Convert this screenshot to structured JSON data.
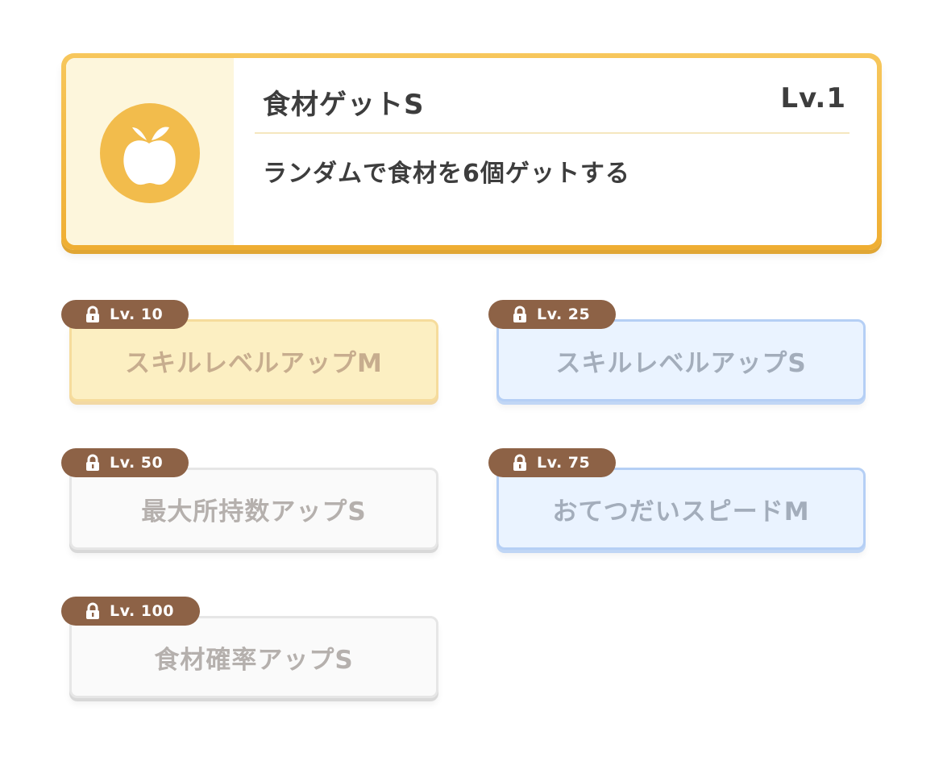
{
  "skill": {
    "icon": "apple-icon",
    "name": "食材ゲットS",
    "level": "Lv.1",
    "description": "ランダムで食材を6個ゲットする",
    "accent_color": "#f2bc4c"
  },
  "unlocks": [
    {
      "level": "Lv. 10",
      "label": "スキルレベルアップM",
      "style": "yellow"
    },
    {
      "level": "Lv. 25",
      "label": "スキルレベルアップS",
      "style": "blue"
    },
    {
      "level": "Lv. 50",
      "label": "最大所持数アップS",
      "style": "white"
    },
    {
      "level": "Lv. 75",
      "label": "おてつだいスピードM",
      "style": "blue"
    },
    {
      "level": "Lv. 100",
      "label": "食材確率アップS",
      "style": "white"
    }
  ],
  "colors": {
    "lock_tag": "#8d6246",
    "yellow": "#fcefc2",
    "blue": "#eaf3ff",
    "white": "#fafafa"
  }
}
